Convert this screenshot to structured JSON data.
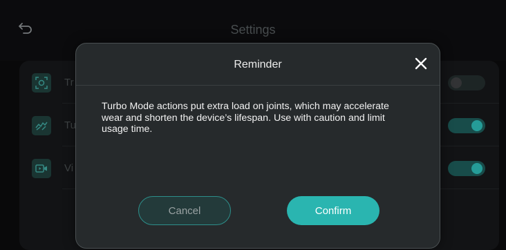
{
  "header": {
    "title": "Settings",
    "back_icon": "back-arrow-icon"
  },
  "settings": {
    "items": [
      {
        "label": "Tr",
        "icon": "target-icon",
        "toggle_on": false
      },
      {
        "label": "Tu",
        "icon": "turbo-icon",
        "toggle_on": true
      },
      {
        "label": "Vi",
        "icon": "video-icon",
        "toggle_on": true
      }
    ]
  },
  "dialog": {
    "title": "Reminder",
    "message": "Turbo Mode actions put extra load on joints, which may accelerate wear and shorten the device’s lifespan. Use with caution and limit usage time.",
    "cancel_label": "Cancel",
    "confirm_label": "Confirm",
    "close_icon": "close-icon"
  },
  "colors": {
    "accent": "#2ab5b0",
    "background": "#0b0b0c",
    "dialog_background": "#262a2c",
    "icon_tile": "#1f3f3b"
  }
}
